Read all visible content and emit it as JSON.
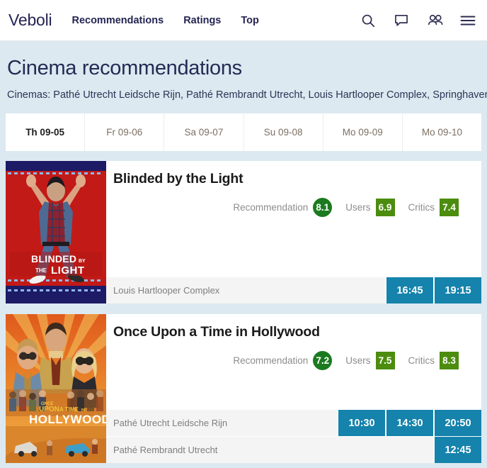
{
  "navbar": {
    "brand": "Veboli",
    "links": [
      {
        "label": "Recommendations",
        "active": true
      },
      {
        "label": "Ratings",
        "active": false
      },
      {
        "label": "Top",
        "active": false
      }
    ],
    "icons": [
      {
        "name": "search-icon"
      },
      {
        "name": "chat-bubble-icon"
      },
      {
        "name": "people-icon"
      },
      {
        "name": "hamburger-menu-icon"
      }
    ]
  },
  "page": {
    "title": "Cinema recommendations",
    "subtitle": "Cinemas: Pathé Utrecht Leidsche Rijn, Pathé Rembrandt Utrecht, Louis Hartlooper Complex, Springhaver"
  },
  "date_tabs": [
    {
      "label": "Th 09-05",
      "active": true
    },
    {
      "label": "Fr 09-06",
      "active": false
    },
    {
      "label": "Sa 09-07",
      "active": false
    },
    {
      "label": "Su 09-08",
      "active": false
    },
    {
      "label": "Mo 09-09",
      "active": false
    },
    {
      "label": "Mo 09-10",
      "active": false
    }
  ],
  "rating_labels": {
    "recommendation": "Recommendation",
    "users": "Users",
    "critics": "Critics"
  },
  "colors": {
    "page_background": "#dce9f0",
    "navbar_background": "#ffffff",
    "brand_text": "#242553",
    "title_text": "#252a55",
    "recommendation_circle": "#1b7a1f",
    "score_square": "#4c8c0f",
    "showtime_button": "#1583ac",
    "showtime_row_background": "#f4f4f4",
    "tab_inactive_text": "#7c6f63"
  },
  "movies": [
    {
      "title": "Blinded by the Light",
      "poster": "blinded-by-the-light-poster",
      "scores": {
        "recommendation": "8.1",
        "users": "6.9",
        "critics": "7.4"
      },
      "showtimes": [
        {
          "cinema": "Louis Hartlooper Complex",
          "times": [
            "16:45",
            "19:15"
          ]
        }
      ]
    },
    {
      "title": "Once Upon a Time in Hollywood",
      "poster": "once-upon-a-time-in-hollywood-poster",
      "scores": {
        "recommendation": "7.2",
        "users": "7.5",
        "critics": "8.3"
      },
      "showtimes": [
        {
          "cinema": "Pathé Utrecht Leidsche Rijn",
          "times": [
            "10:30",
            "14:30",
            "20:50"
          ]
        },
        {
          "cinema": "Pathé Rembrandt Utrecht",
          "times": [
            "12:45"
          ]
        }
      ]
    }
  ]
}
